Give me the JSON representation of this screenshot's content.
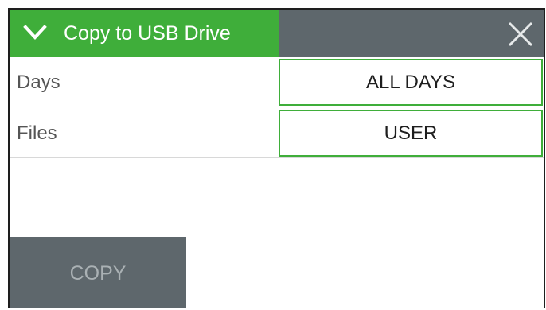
{
  "header": {
    "title": "Copy to USB Drive",
    "accent_color": "#3fae3a",
    "bar_color": "#5e676c",
    "collapse_icon": "chevron-down-icon",
    "close_icon": "close-icon"
  },
  "rows": [
    {
      "label": "Days",
      "value": "ALL DAYS"
    },
    {
      "label": "Files",
      "value": "USER"
    }
  ],
  "actions": {
    "copy_label": "COPY"
  }
}
